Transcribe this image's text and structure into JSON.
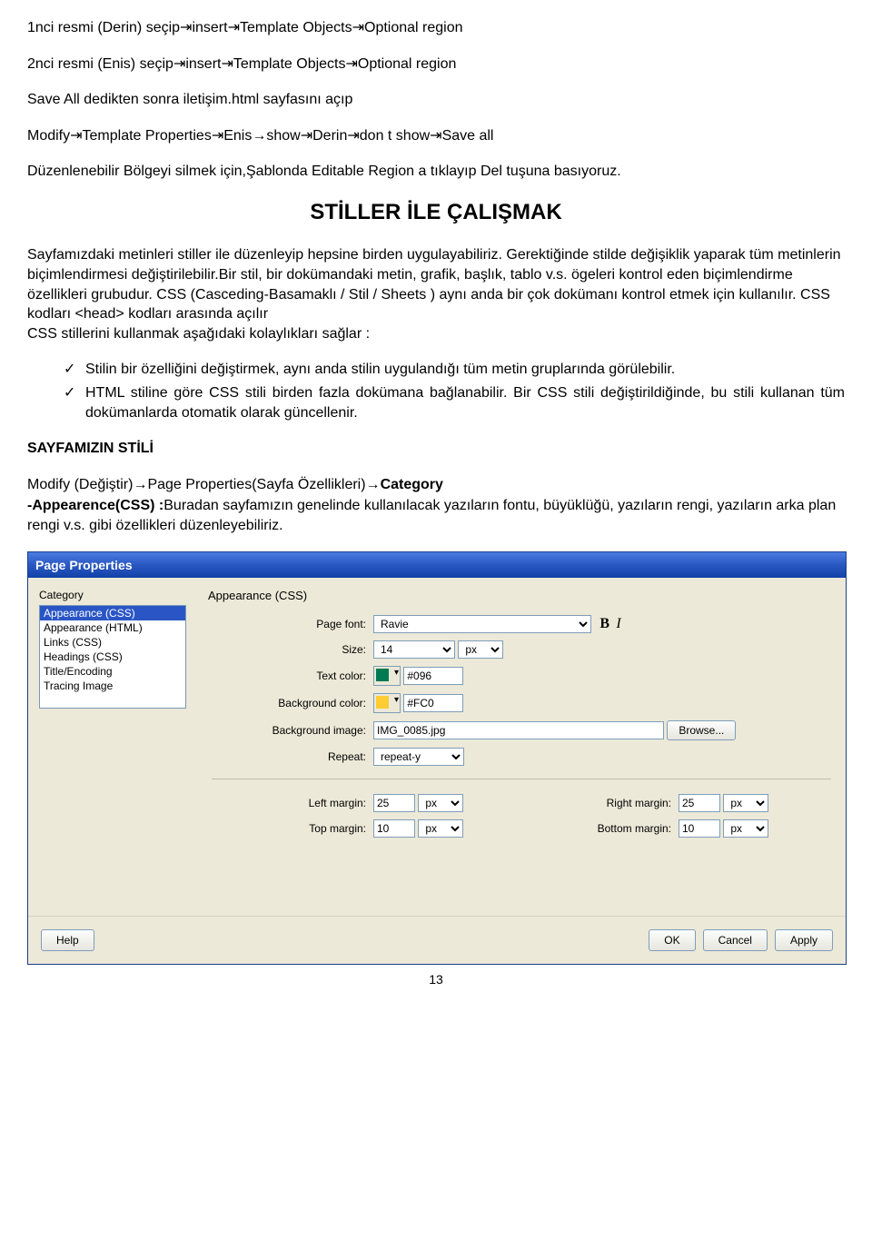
{
  "article": {
    "p1_a": "1nci resmi (Derin) seçip",
    "p1_b": "insert",
    "p1_c": "Template Objects",
    "p1_d": "Optional region",
    "p2_a": "2nci resmi (Enis) seçip",
    "p2_b": "insert",
    "p2_c": "Template Objects",
    "p2_d": "Optional region",
    "p3": "Save All dedikten sonra iletişim.html sayfasını açıp",
    "p4_a": "Modify",
    "p4_b": "Template Properties",
    "p4_c": "Enis→show",
    "p4_d": "Derin",
    "p4_e": "don t show",
    "p4_f": "Save all",
    "p5": "Düzenlenebilir Bölgeyi silmek için,Şablonda Editable Region a tıklayıp Del tuşuna basıyoruz.",
    "heading": "STİLLER İLE ÇALIŞMAK",
    "p6": "Sayfamızdaki metinleri stiller ile düzenleyip hepsine birden uygulayabiliriz. Gerektiğinde stilde değişiklik yaparak tüm metinlerin biçimlendirmesi değiştirilebilir.Bir stil, bir dokümandaki metin, grafik, başlık, tablo v.s. ögeleri kontrol eden biçimlendirme özellikleri grubudur. CSS (Casceding-Basamaklı / Stil / Sheets ) aynı anda bir çok dokümanı kontrol etmek için kullanılır. CSS kodları <head> kodları arasında açılır",
    "p6b": "CSS stillerini kullanmak aşağıdaki kolaylıkları sağlar :",
    "li1": "Stilin bir özelliğini değiştirmek, aynı anda stilin uygulandığı tüm metin gruplarında görülebilir.",
    "li2": "HTML stiline göre CSS stili birden fazla dokümana bağlanabilir. Bir CSS stili değiştirildiğinde, bu stili kullanan tüm dokümanlarda otomatik olarak güncellenir.",
    "h2": "SAYFAMIZIN STİLİ",
    "p7_a": "Modify (Değiştir)→Page Properties(Sayfa Özellikleri)→",
    "p7_b": "Category",
    "p8_a": "-Appearence(CSS) :",
    "p8_b": "Buradan sayfamızın genelinde kullanılacak yazıların fontu, büyüklüğü, yazıların rengi, yazıların arka plan rengi v.s. gibi özellikleri düzenleyebiliriz."
  },
  "dialog": {
    "title": "Page Properties",
    "category_label": "Category",
    "categories": [
      "Appearance (CSS)",
      "Appearance (HTML)",
      "Links (CSS)",
      "Headings (CSS)",
      "Title/Encoding",
      "Tracing Image"
    ],
    "section": "Appearance (CSS)",
    "labels": {
      "page_font": "Page font:",
      "size": "Size:",
      "text_color": "Text color:",
      "bg_color": "Background color:",
      "bg_image": "Background image:",
      "repeat": "Repeat:",
      "left_margin": "Left margin:",
      "right_margin": "Right margin:",
      "top_margin": "Top margin:",
      "bottom_margin": "Bottom margin:"
    },
    "values": {
      "font": "Ravie",
      "size": "14",
      "size_unit": "px",
      "text_color": "#096",
      "bg_color": "#FC0",
      "bg_image": "IMG_0085.jpg",
      "repeat": "repeat-y",
      "left_margin": "25",
      "right_margin": "25",
      "top_margin": "10",
      "bottom_margin": "10",
      "margin_unit": "px"
    },
    "buttons": {
      "browse": "Browse...",
      "help": "Help",
      "ok": "OK",
      "cancel": "Cancel",
      "apply": "Apply"
    },
    "bold": "B",
    "italic": "I"
  },
  "page_number": "13"
}
